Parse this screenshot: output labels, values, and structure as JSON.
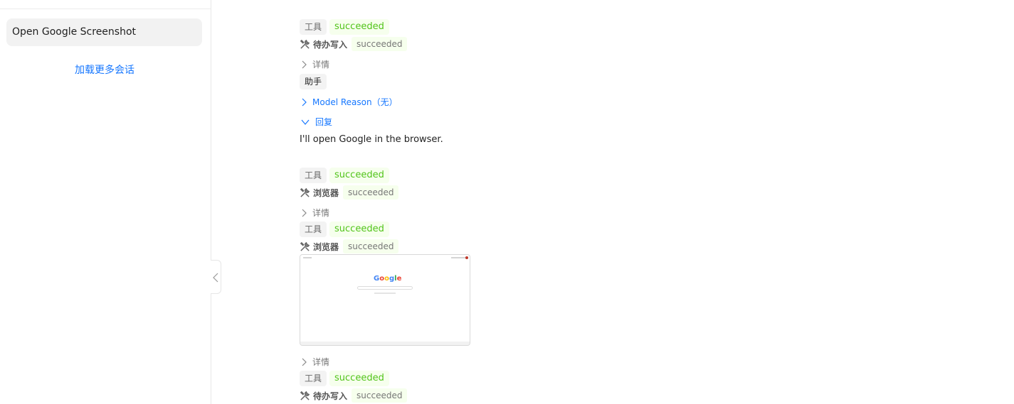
{
  "sidebar": {
    "conversation_title": "Open Google Screenshot",
    "load_more": "加载更多会话"
  },
  "main": {
    "details_label": "详情",
    "block1": {
      "tool_label": "工具",
      "status": "succeeded",
      "tool_name": "待办写入",
      "sub_status": "succeeded"
    },
    "assistant": {
      "role_label": "助手",
      "reason_label": "Model Reason（无）",
      "reply_label": "回复",
      "reply_text": "I'll open Google in the browser."
    },
    "block2": {
      "tool_label": "工具",
      "status": "succeeded",
      "tool_name": "浏览器",
      "sub_status": "succeeded"
    },
    "block3": {
      "tool_label": "工具",
      "status": "succeeded",
      "tool_name": "浏览器",
      "sub_status": "succeeded"
    },
    "screenshot": {
      "logo_text": "Google"
    },
    "block4": {
      "tool_label": "工具",
      "status": "succeeded",
      "tool_name": "待办写入",
      "sub_status": "succeeded"
    }
  },
  "colors": {
    "accent": "#1677ff",
    "success": "#52c41a",
    "success_bg": "#f6ffed",
    "sidebar_active": "#f2f2f2"
  },
  "icons": {
    "tool": "tools-icon",
    "expand": "chevron-right-icon",
    "collapse": "chevron-down-icon",
    "sidebar_toggle": "chevron-left-icon"
  }
}
